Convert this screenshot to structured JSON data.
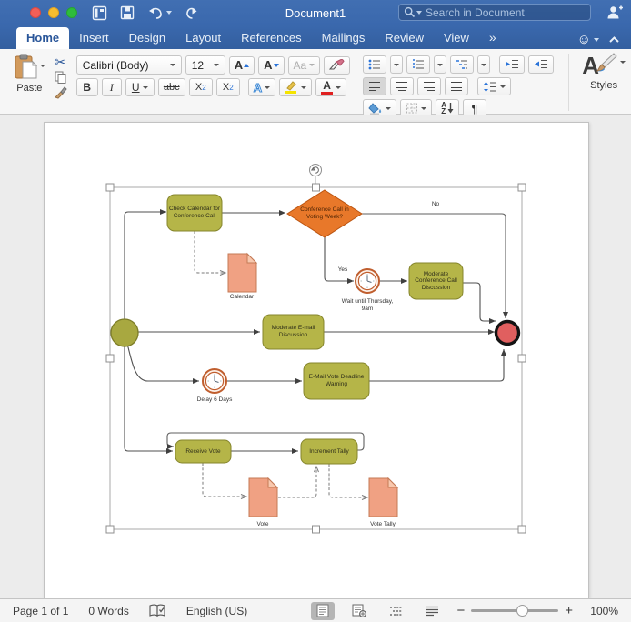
{
  "titlebar": {
    "title": "Document1",
    "search_placeholder": "Search in Document"
  },
  "tabs": {
    "items": [
      "Home",
      "Insert",
      "Design",
      "Layout",
      "References",
      "Mailings",
      "Review",
      "View"
    ],
    "active": "Home",
    "overflow_glyph": "»",
    "feedback_glyph": "☺"
  },
  "ribbon": {
    "paste_label": "Paste",
    "font_name": "Calibri (Body)",
    "font_size": "12",
    "styles_label": "Styles",
    "buttons": {
      "scissors_glyph": "✂",
      "grow_font": "A",
      "shrink_font": "A",
      "change_case": "Aa",
      "bold": "B",
      "italic": "I",
      "underline": "U",
      "strike": "abc",
      "sub_base": "X",
      "sub_script": "2",
      "sup_base": "X",
      "sup_script": "2",
      "text_effect": "A",
      "font_color": "A",
      "sort_a": "A",
      "sort_z": "Z",
      "pilcrow": "¶",
      "styles_a": "A"
    }
  },
  "statusbar": {
    "page": "Page 1 of 1",
    "words": "0 Words",
    "language": "English (US)",
    "zoom_out": "−",
    "zoom_in": "+",
    "zoom_level": "100%"
  },
  "diagram": {
    "nodes": {
      "check_calendar": "Check Calendar for Conference Call",
      "gateway": "Conference Call in Voting Week?",
      "moderate_conf": "Moderate Conference Call Discussion",
      "moderate_email": "Moderate E-mail Discussion",
      "email_deadline": "E-Mail Vote Deadline Warning",
      "receive_vote": "Receive Vote",
      "increment_tally": "Increment Tally",
      "wait_label": "Wait until Thursday, 9am",
      "delay_label": "Delay 6 Days",
      "calendar_doc": "Calendar",
      "vote_doc": "Vote",
      "vote_tally_doc": "Vote Tally",
      "yes": "Yes",
      "no": "No"
    },
    "colors": {
      "task_fill": "#b5b548",
      "task_stroke": "#85852c",
      "gateway_fill": "#e8782a",
      "gateway_stroke": "#bb5410",
      "doc_fill": "#f0a183",
      "doc_stroke": "#c47a56",
      "start_fill": "#a8a840",
      "end_fill": "#e05f5f",
      "connector": "#4f4f4f"
    }
  }
}
